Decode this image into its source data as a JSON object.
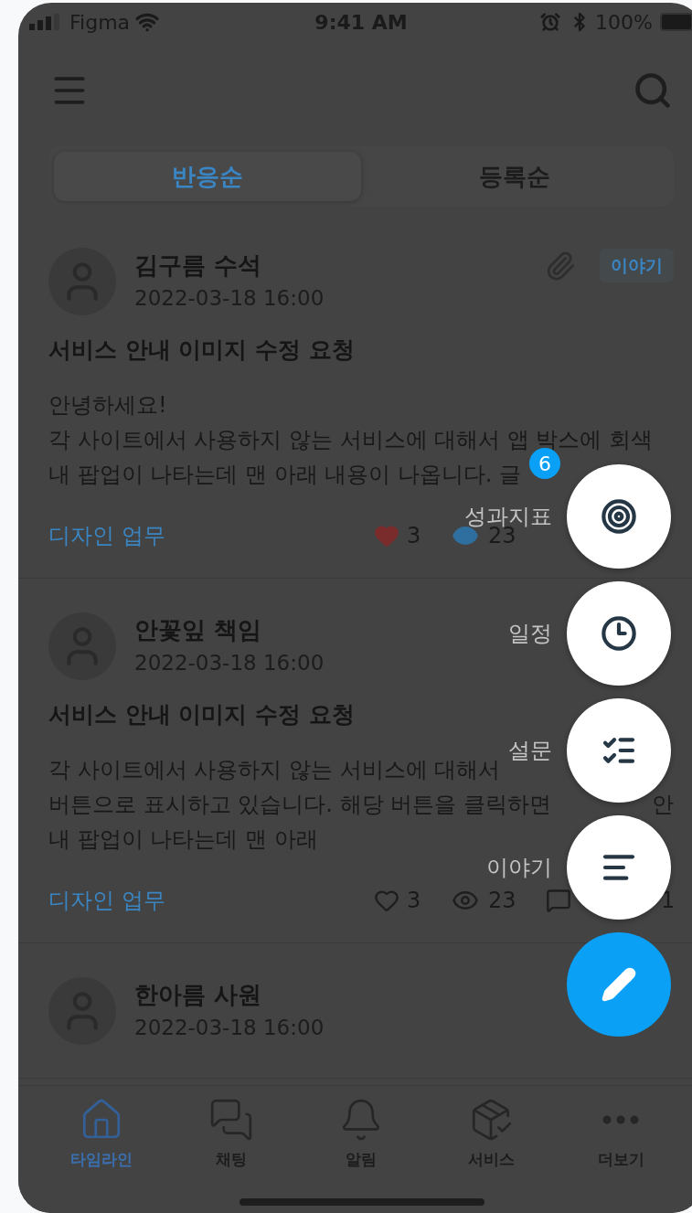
{
  "status_bar": {
    "carrier": "Figma",
    "time": "9:41 AM",
    "battery": "100%"
  },
  "tabs": [
    {
      "label": "반응순",
      "selected": true
    },
    {
      "label": "등록순",
      "selected": false
    }
  ],
  "posts": [
    {
      "author": "김구름 수석",
      "date": "2022-03-18 16:00",
      "attachment": true,
      "tag": "이야기",
      "title": "서비스 안내 이미지 수정 요청",
      "body": [
        "안녕하세요!",
        "각 사이트에서 사용하지 않는 서비스에 대해서 앱 박스에 회색",
        "내 팝업이 나타는데 맨 아래 내용이 나옵니다. 글"
      ],
      "category": "디자인 업무",
      "liked": true,
      "likes": "3",
      "viewed": true,
      "views": "23"
    },
    {
      "author": "안꽃잎 책임",
      "date": "2022-03-18 16:00",
      "title": "서비스 안내 이미지 수정 요청",
      "body": [
        "각 사이트에서 사용하지 않는 서비스에 대해서",
        {
          "text": "버튼으로 표시하고 있습니다. 해당 버튼을 클릭하면",
          "tail": "안"
        },
        "내 팝업이 나타는데 맨 아래"
      ],
      "category": "디자인 업무",
      "liked": false,
      "likes": "3",
      "viewed": false,
      "views": "23",
      "comments": "1"
    },
    {
      "author": "한아름 사원",
      "date": "2022-03-18 16:00"
    }
  ],
  "fab_menu": [
    {
      "kind": "target",
      "label": "성과지표",
      "badge": "6"
    },
    {
      "kind": "clock",
      "label": "일정"
    },
    {
      "kind": "checklist",
      "label": "설문"
    },
    {
      "kind": "lines",
      "label": "이야기"
    }
  ],
  "nav": [
    {
      "kind": "home",
      "label": "타임라인",
      "selected": true
    },
    {
      "kind": "chat",
      "label": "채팅",
      "selected": false
    },
    {
      "kind": "bell",
      "label": "알림",
      "selected": false
    },
    {
      "kind": "box",
      "label": "서비스",
      "selected": false
    },
    {
      "kind": "more",
      "label": "더보기",
      "selected": false
    }
  ]
}
